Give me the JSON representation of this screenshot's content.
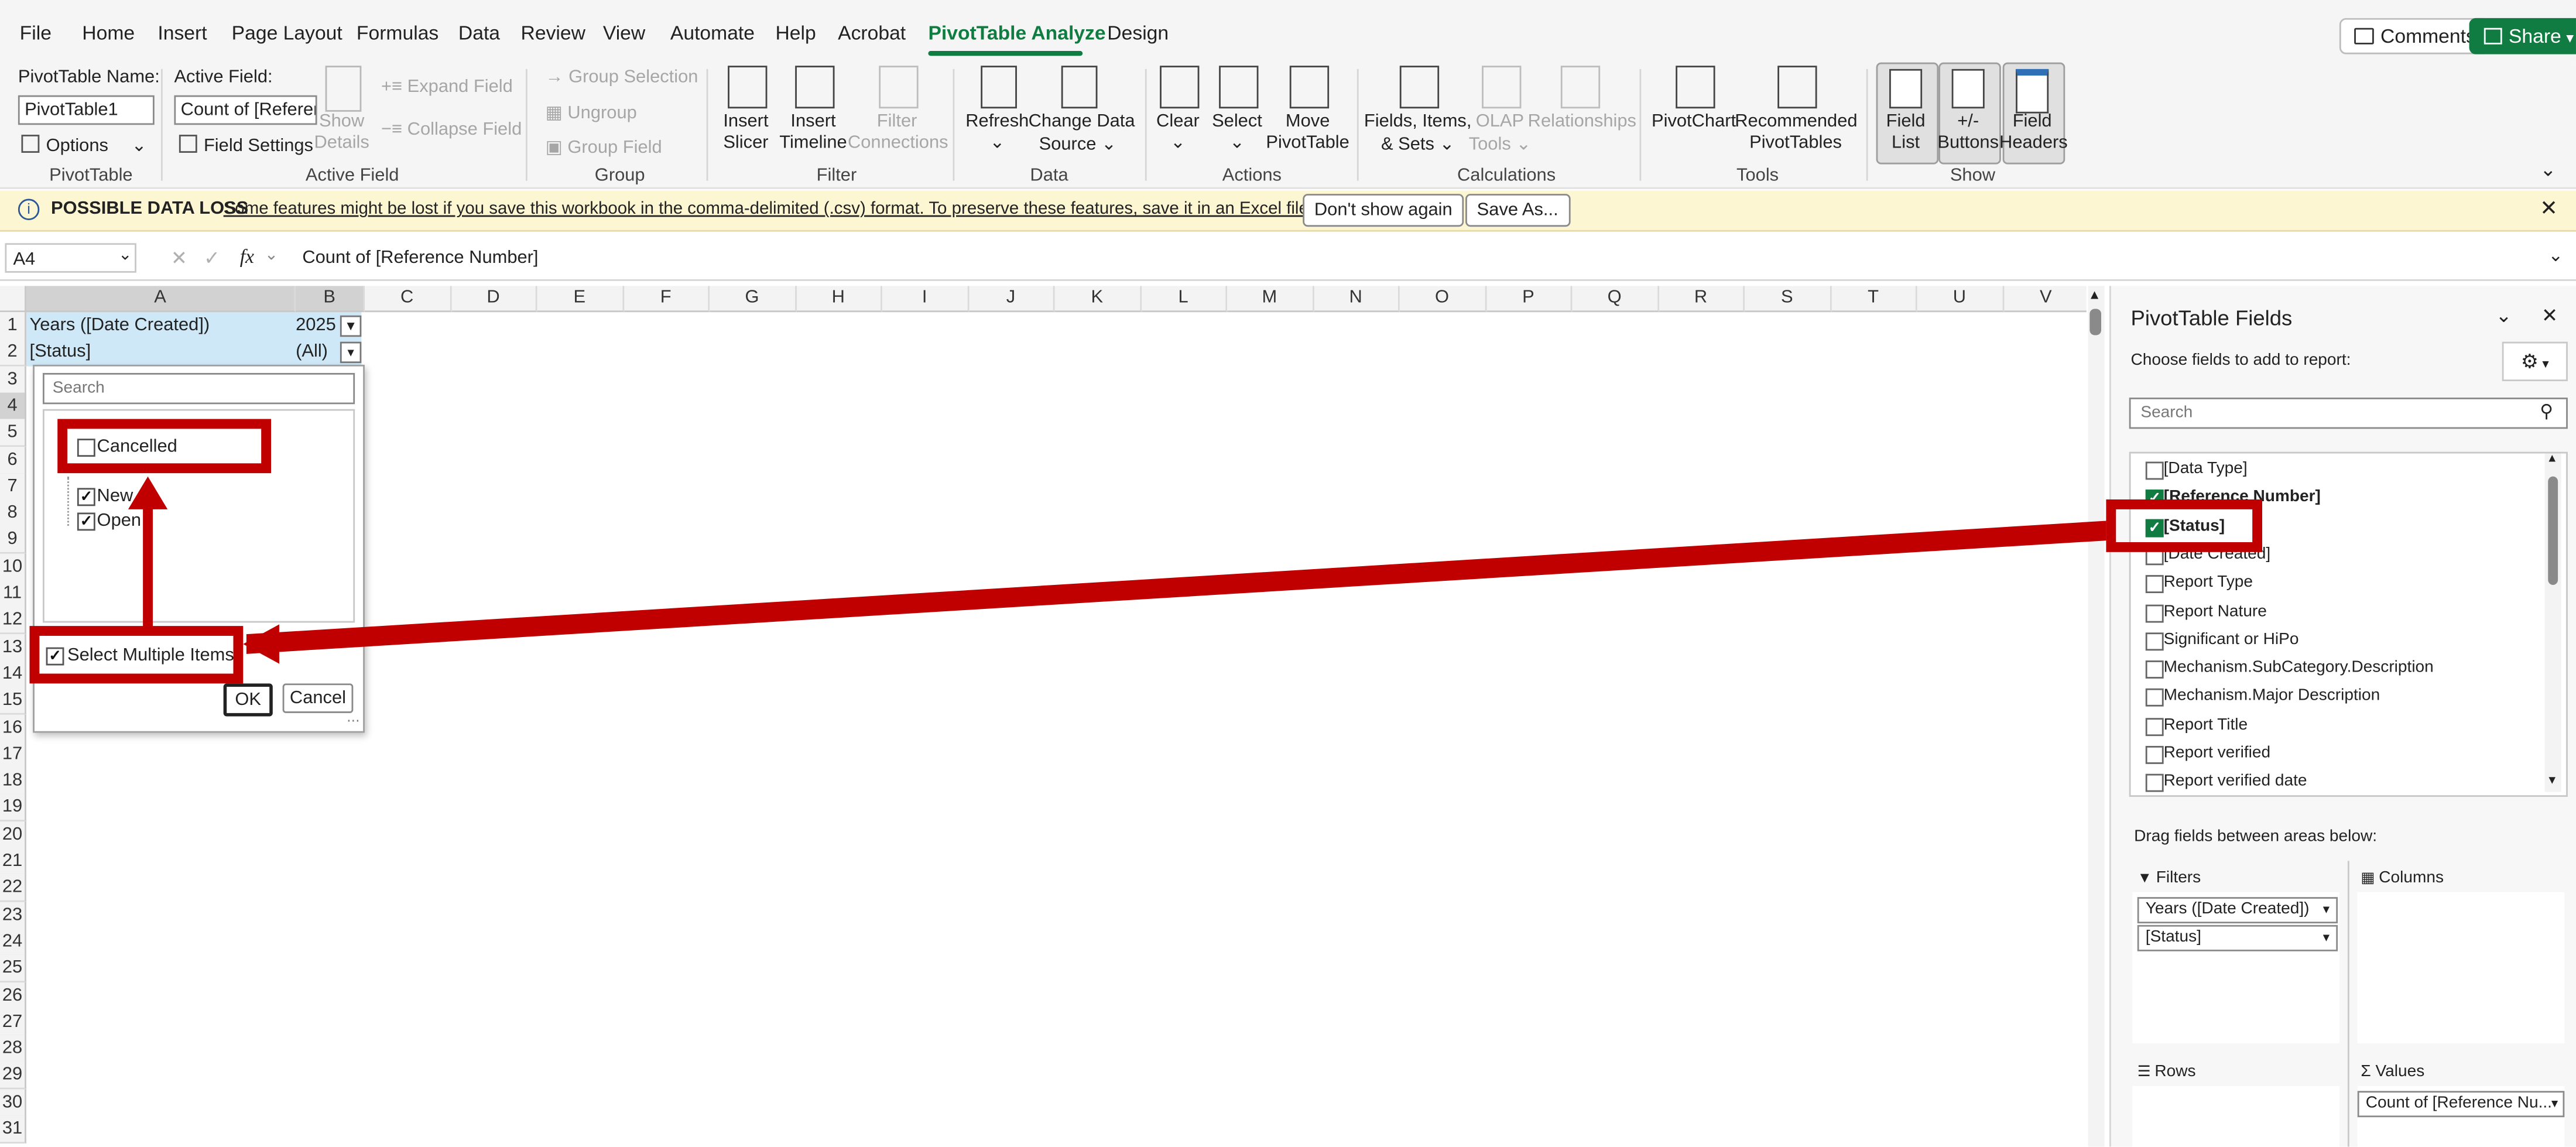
{
  "menu": {
    "items": [
      "File",
      "Home",
      "Insert",
      "Page Layout",
      "Formulas",
      "Data",
      "Review",
      "View",
      "Automate",
      "Help",
      "Acrobat",
      "PivotTable Analyze",
      "Design"
    ],
    "active": "PivotTable Analyze",
    "comments": "Comments",
    "share": "Share"
  },
  "ribbon": {
    "pivot_name_label": "PivotTable Name:",
    "pivot_name_value": "PivotTable1",
    "options": "Options",
    "group_pivottable": "PivotTable",
    "active_field_label": "Active Field:",
    "active_field_value": "Count of [Referenc",
    "field_settings": "Field Settings",
    "show_details_1": "Show",
    "show_details_2": "Details",
    "expand_field": "Expand Field",
    "collapse_field": "Collapse Field",
    "group_active_field": "Active Field",
    "group_selection": "Group Selection",
    "ungroup": "Ungroup",
    "group_field": "Group Field",
    "group_group": "Group",
    "insert_slicer_1": "Insert",
    "insert_slicer_2": "Slicer",
    "insert_timeline_1": "Insert",
    "insert_timeline_2": "Timeline",
    "filter_connections_1": "Filter",
    "filter_connections_2": "Connections",
    "group_filter": "Filter",
    "refresh": "Refresh",
    "change_data_1": "Change Data",
    "change_data_2": "Source",
    "group_data": "Data",
    "clear": "Clear",
    "select": "Select",
    "move_1": "Move",
    "move_2": "PivotTable",
    "group_actions": "Actions",
    "fields_items_1": "Fields, Items,",
    "fields_items_2": "& Sets",
    "olap_1": "OLAP",
    "olap_2": "Tools",
    "relationships": "Relationships",
    "group_calculations": "Calculations",
    "pivotchart": "PivotChart",
    "recommended_1": "Recommended",
    "recommended_2": "PivotTables",
    "group_tools": "Tools",
    "field_list_1": "Field",
    "field_list_2": "List",
    "buttons_1": "+/-",
    "buttons_2": "Buttons",
    "field_headers_1": "Field",
    "field_headers_2": "Headers",
    "group_show": "Show"
  },
  "banner": {
    "title": "POSSIBLE DATA LOSS",
    "message": "Some features might be lost if you save this workbook in the comma-delimited (.csv) format. To preserve these features, save it in an Excel file format.",
    "dont_show": "Don't show again",
    "save_as": "Save As..."
  },
  "formula": {
    "name_box": "A4",
    "fx": "fx",
    "content": "Count of [Reference Number]"
  },
  "grid": {
    "columns": [
      "A",
      "B",
      "C",
      "D",
      "E",
      "F",
      "G",
      "H",
      "I",
      "J",
      "K",
      "L",
      "M",
      "N",
      "O",
      "P",
      "Q",
      "R",
      "S",
      "T",
      "U",
      "V"
    ],
    "rows": [
      "1",
      "2",
      "3",
      "4",
      "5",
      "6",
      "7",
      "8",
      "9",
      "10",
      "11",
      "12",
      "13",
      "14",
      "15",
      "16",
      "17",
      "18",
      "19",
      "20",
      "21",
      "22",
      "23",
      "24",
      "25",
      "26",
      "27",
      "28",
      "29",
      "30",
      "31"
    ],
    "a1": "Years ([Date Created])",
    "b1": "2025",
    "a2": "[Status]",
    "b2": "(All)"
  },
  "dropdown": {
    "search_placeholder": "Search",
    "items": [
      {
        "label": "Cancelled",
        "checked": false
      },
      {
        "label": "New",
        "checked": true
      },
      {
        "label": "Open",
        "checked": true
      }
    ],
    "select_multiple": "Select Multiple Items",
    "ok": "OK",
    "cancel": "Cancel"
  },
  "pane": {
    "title": "PivotTable Fields",
    "subtitle": "Choose fields to add to report:",
    "search_placeholder": "Search",
    "fields": [
      {
        "label": "[Data Type]",
        "checked": false
      },
      {
        "label": "[Reference Number]",
        "checked": true
      },
      {
        "label": "[Status]",
        "checked": true
      },
      {
        "label": "[Date Created]",
        "checked": false
      },
      {
        "label": "Report Type",
        "checked": false
      },
      {
        "label": "Report Nature",
        "checked": false
      },
      {
        "label": "Significant or HiPo",
        "checked": false
      },
      {
        "label": "Mechanism.SubCategory.Description",
        "checked": false
      },
      {
        "label": "Mechanism.Major Description",
        "checked": false
      },
      {
        "label": "Report Title",
        "checked": false
      },
      {
        "label": "Report verified",
        "checked": false
      },
      {
        "label": "Report verified date",
        "checked": false
      }
    ],
    "drag_label": "Drag fields between areas below:",
    "filters": "Filters",
    "columns": "Columns",
    "rows": "Rows",
    "values": "Values",
    "filter_chips": [
      "Years ([Date Created])",
      "[Status]"
    ],
    "value_chips": [
      "Count of [Reference Nu..."
    ]
  },
  "colors": {
    "accent": "#107c41",
    "annotation": "#c00000",
    "banner_bg": "#fdf6d3",
    "header_fill": "#cfe8f7"
  }
}
